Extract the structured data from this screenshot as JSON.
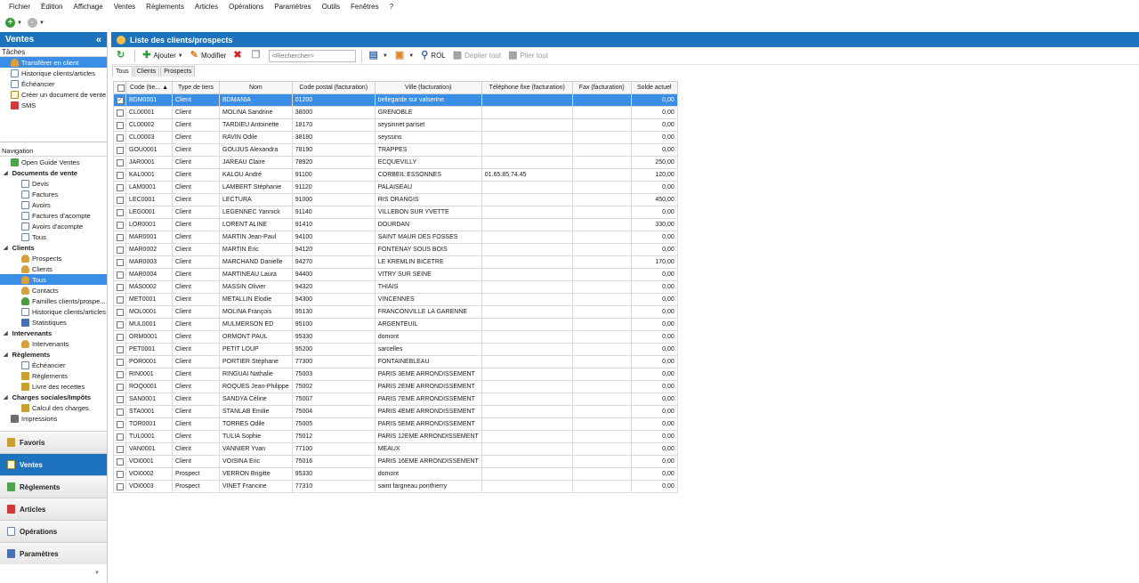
{
  "menubar": [
    "Fichier",
    "Édition",
    "Affichage",
    "Ventes",
    "Règlements",
    "Articles",
    "Opérations",
    "Paramètres",
    "Outils",
    "Fenêtres",
    "?"
  ],
  "sidebar": {
    "title": "Ventes",
    "collapse": "«",
    "tasks_title": "Tâches",
    "tasks": [
      "Transférer en client",
      "Historique clients/articles",
      "Échéancier",
      "Créer un document de vente",
      "SMS"
    ],
    "navigation_title": "Navigation",
    "nav": [
      {
        "level": "top",
        "label": "Open Guide Ventes",
        "icon": "guide-icon"
      },
      {
        "level": 1,
        "label": "Documents de vente"
      },
      {
        "level": 2,
        "label": "Devis",
        "icon": "document-icon"
      },
      {
        "level": 2,
        "label": "Factures",
        "icon": "document-icon"
      },
      {
        "level": 2,
        "label": "Avoirs",
        "icon": "document-icon"
      },
      {
        "level": 2,
        "label": "Factures d'acompte",
        "icon": "document-icon"
      },
      {
        "level": 2,
        "label": "Avoirs d'acompte",
        "icon": "document-icon"
      },
      {
        "level": 2,
        "label": "Tous",
        "icon": "document-icon"
      },
      {
        "level": 1,
        "label": "Clients"
      },
      {
        "level": 2,
        "label": "Prospects",
        "icon": "person-icon"
      },
      {
        "level": 2,
        "label": "Clients",
        "icon": "person-icon"
      },
      {
        "level": 2,
        "label": "Tous",
        "icon": "person-icon",
        "selected": true
      },
      {
        "level": 2,
        "label": "Contacts",
        "icon": "person-icon"
      },
      {
        "level": 2,
        "label": "Familles clients/prospe...",
        "icon": "group-icon"
      },
      {
        "level": 2,
        "label": "Historique clients/articles",
        "icon": "history-icon"
      },
      {
        "level": 2,
        "label": "Statistiques",
        "icon": "chart-icon"
      },
      {
        "level": 1,
        "label": "Intervenants"
      },
      {
        "level": 2,
        "label": "Intervenants",
        "icon": "person-icon"
      },
      {
        "level": 1,
        "label": "Règlements"
      },
      {
        "level": 2,
        "label": "Échéancier",
        "icon": "calendar-icon"
      },
      {
        "level": 2,
        "label": "Règlements",
        "icon": "money-icon"
      },
      {
        "level": 2,
        "label": "Livre des recettes",
        "icon": "money-icon"
      },
      {
        "level": 1,
        "label": "Charges sociales/Impôts"
      },
      {
        "level": 2,
        "label": "Calcul des charges",
        "icon": "scale-icon"
      },
      {
        "level": "top",
        "label": "Impressions",
        "icon": "printer-icon"
      }
    ],
    "big_buttons": [
      "Favoris",
      "Ventes",
      "Règlements",
      "Articles",
      "Opérations",
      "Paramètres"
    ]
  },
  "main": {
    "title": "Liste des clients/prospects",
    "toolbar": {
      "add": "Ajouter",
      "modify": "Modifier",
      "search_placeholder": "<Rechercher>",
      "rol": "ROL",
      "expand": "Déplier tout",
      "collapse": "Plier tout"
    },
    "tabs": [
      "Tous",
      "Clients",
      "Prospects"
    ],
    "columns": [
      "Code (tie...",
      "Type de tiers",
      "Nom",
      "Code postal (facturation)",
      "Ville (facturation)",
      "Téléphone fixe (facturation)",
      "Fax (facturation)",
      "Solde actuel"
    ],
    "rows": [
      [
        "BDM0001",
        "Client",
        "BDMANIA",
        "01200",
        "bellegarde sur valserine",
        "",
        "",
        "0,00"
      ],
      [
        "CL00001",
        "Client",
        "MOLINA Sandrine",
        "38000",
        "GRENOBLE",
        "",
        "",
        "0,00"
      ],
      [
        "CL00002",
        "Client",
        "TARDIEU Antoinette",
        "18170",
        "seysinnet pariset",
        "",
        "",
        "0,00"
      ],
      [
        "CL00003",
        "Client",
        "RAVIN Odile",
        "38180",
        "seyssins",
        "",
        "",
        "0,00"
      ],
      [
        "GOU0001",
        "Client",
        "GOUJUS Alexandra",
        "78190",
        "TRAPPES",
        "",
        "",
        "0,00"
      ],
      [
        "JAR0001",
        "Client",
        "JAREAU Claire",
        "78920",
        "ECQUEVILLY",
        "",
        "",
        "250,00"
      ],
      [
        "KAL0001",
        "Client",
        "KALOU André",
        "91100",
        "CORBEIL ESSONNES",
        "01.65.85.74.45",
        "",
        "120,00"
      ],
      [
        "LAM0001",
        "Client",
        "LAMBERT Stéphanie",
        "91120",
        "PALAISEAU",
        "",
        "",
        "0,00"
      ],
      [
        "LEC0001",
        "Client",
        "LECTURA",
        "91000",
        "RIS ORANGIS",
        "",
        "",
        "450,00"
      ],
      [
        "LEG0001",
        "Client",
        "LEGENNEC Yannick",
        "91140",
        "VILLEBON SUR YVETTE",
        "",
        "",
        "0,00"
      ],
      [
        "LOR0001",
        "Client",
        "LORENT ALINE",
        "91410",
        "DOURDAN",
        "",
        "",
        "330,00"
      ],
      [
        "MAR0001",
        "Client",
        "MARTIN Jean-Paul",
        "94100",
        "SAINT MAUR DES FOSSES",
        "",
        "",
        "0,00"
      ],
      [
        "MAR0002",
        "Client",
        "MARTIN Eric",
        "94120",
        "FONTENAY SOUS BOIS",
        "",
        "",
        "0,00"
      ],
      [
        "MAR0003",
        "Client",
        "MARCHAND Danielle",
        "94270",
        "LE KREMLIN BICETRE",
        "",
        "",
        "170,00"
      ],
      [
        "MAR0004",
        "Client",
        "MARTINEAU Laura",
        "94400",
        "VITRY SUR SEINE",
        "",
        "",
        "0,00"
      ],
      [
        "MAS0002",
        "Client",
        "MASSIN Olivier",
        "94320",
        "THIAIS",
        "",
        "",
        "0,00"
      ],
      [
        "MET0001",
        "Client",
        "METALLIN Elodie",
        "94300",
        "VINCENNES",
        "",
        "",
        "0,00"
      ],
      [
        "MOL0001",
        "Client",
        "MOLINA François",
        "95130",
        "FRANCONVILLE LA GARENNE",
        "",
        "",
        "0,00"
      ],
      [
        "MUL0001",
        "Client",
        "MULMERSON ED",
        "95100",
        "ARGENTEUIL",
        "",
        "",
        "0,00"
      ],
      [
        "ORM0001",
        "Client",
        "ORMONT PAUL",
        "95330",
        "domont",
        "",
        "",
        "0,00"
      ],
      [
        "PET0001",
        "Client",
        "PETIT LOUP",
        "95200",
        "sarcelles",
        "",
        "",
        "0,00"
      ],
      [
        "POR0001",
        "Client",
        "PORTIER Stéphane",
        "77300",
        "FONTAINEBLEAU",
        "",
        "",
        "0,00"
      ],
      [
        "RIN0001",
        "Client",
        "RINGUAI Nathalie",
        "75003",
        "PARIS 3EME ARRONDISSEMENT",
        "",
        "",
        "0,00"
      ],
      [
        "ROQ0001",
        "Client",
        "ROQUES Jean-Philippe",
        "75002",
        "PARIS 2EME ARRONDISSEMENT",
        "",
        "",
        "0,00"
      ],
      [
        "SAN0001",
        "Client",
        "SANDYA Céline",
        "75007",
        "PARIS 7EME ARRONDISSEMENT",
        "",
        "",
        "0,00"
      ],
      [
        "STA0001",
        "Client",
        "STANLAB Emilie",
        "75004",
        "PARIS 4EME ARRONDISSEMENT",
        "",
        "",
        "0,00"
      ],
      [
        "TOR0001",
        "Client",
        "TORRES Odile",
        "75005",
        "PARIS 5EME ARRONDISSEMENT",
        "",
        "",
        "0,00"
      ],
      [
        "TUL0001",
        "Client",
        "TULIA Sophie",
        "75012",
        "PARIS 12EME ARRONDISSEMENT",
        "",
        "",
        "0,00"
      ],
      [
        "VAN0001",
        "Client",
        "VANNIER Yvan",
        "77100",
        "MEAUX",
        "",
        "",
        "0,00"
      ],
      [
        "VOI0001",
        "Client",
        "VOISINA Eric",
        "75016",
        "PARIS 16EME ARRONDISSEMENT",
        "",
        "",
        "0,00"
      ],
      [
        "VOI0002",
        "Prospect",
        "VERRON Brigitte",
        "95330",
        "domont",
        "",
        "",
        "0,00"
      ],
      [
        "VOI0003",
        "Prospect",
        "VINET Francine",
        "77310",
        "saint fargneau ponthierry",
        "",
        "",
        "0,00"
      ]
    ],
    "selected_row": 0,
    "sort_indicator": "▲"
  }
}
